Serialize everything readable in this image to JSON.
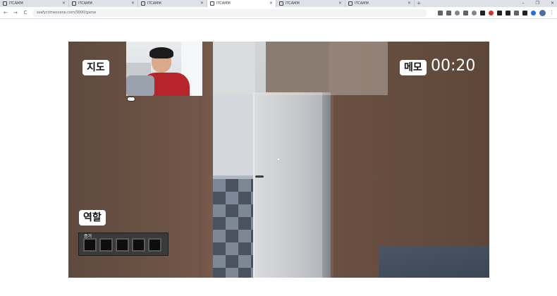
{
  "browser": {
    "tabs": [
      {
        "title": "ITCAMM",
        "active": false
      },
      {
        "title": "ITCAMM",
        "active": false
      },
      {
        "title": "ITCAMM",
        "active": false
      },
      {
        "title": "ITCAMM",
        "active": true
      },
      {
        "title": "ITCAMM",
        "active": false
      },
      {
        "title": "ITCAMM",
        "active": false
      }
    ],
    "new_tab": "+",
    "url": "ssafycrimescene.com/3000/game",
    "nav": {
      "back": "←",
      "forward": "→",
      "reload": "C"
    },
    "window": {
      "minimize": "–",
      "maximize": "❐",
      "close": "✕"
    }
  },
  "hud": {
    "map_label": "지도",
    "memo_label": "메모",
    "timer": "00:20",
    "role_label": "역할",
    "evidence_label": "증거",
    "evidence_slots": 5,
    "webcam_toggle": "^"
  }
}
